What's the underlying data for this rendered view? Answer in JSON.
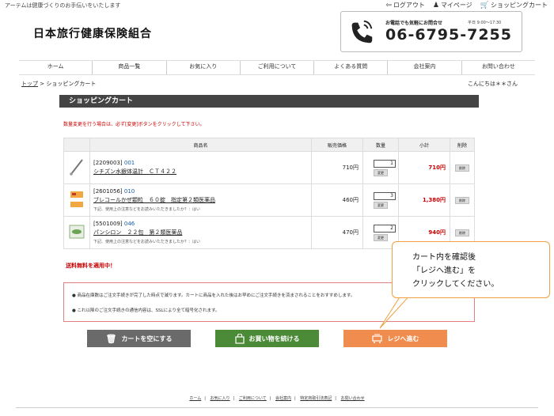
{
  "header": {
    "tagline": "アーテムは健康づくりのお手伝いをいたします",
    "links": [
      {
        "icon": "logout-icon",
        "glyph": "⇦",
        "label": "ログアウト"
      },
      {
        "icon": "user-icon",
        "glyph": "👤",
        "label": "マイページ"
      },
      {
        "icon": "cart-icon",
        "glyph": "🛒",
        "label": "ショッピングカート"
      }
    ],
    "logo": "日本旅行健康保険組合",
    "contact": {
      "label": "お電話でも気軽にお問合せ",
      "hours": "平日 9:00〜17:30",
      "phone": "06-6795-7255"
    }
  },
  "nav": [
    "ホーム",
    "商品一覧",
    "お気に入り",
    "ご利用について",
    "よくある質問",
    "会社案内",
    "お問い合わせ"
  ],
  "breadcrumb": {
    "top": "トップ",
    "separator": " > ",
    "current": "ショッピングカート"
  },
  "greeting": "こんにちは＊＊さん",
  "panel": {
    "title": "ショッピングカート",
    "notice": "数量変更を行う場合は、必ず[変更]ボタンをクリックして下さい。",
    "columns": [
      "",
      "商品名",
      "販売価格",
      "数量",
      "小計",
      "削除"
    ],
    "items": [
      {
        "code": "[2209003]",
        "sub": "001",
        "name": "シチズン水銀体温計　ＣＴ４２２",
        "note": "",
        "price": "710円",
        "qty": "1",
        "subtotal": "710円"
      },
      {
        "code": "[2601056]",
        "sub": "010",
        "name": "ブレコールかぜ顆粒　６０錠　指定第２類医薬品",
        "note": "下記、使用上の注意などをお読みいただきましたか？：はい",
        "price": "460円",
        "qty": "3",
        "subtotal": "1,380円"
      },
      {
        "code": "[5501009]",
        "sub": "046",
        "name": "パンシロン　２２包　第２類医薬品",
        "note": "下記、使用上の注意などをお読みいただきましたか？：はい",
        "price": "470円",
        "qty": "2",
        "subtotal": "940円"
      }
    ],
    "change_label": "変更",
    "delete_label": "削除",
    "shipping": "送料無料を適用中！",
    "info": [
      "● 商品在庫数はご注文手続きが完了した時点で減ります。カートに商品を入れた後はお早めにご注文手続きを済まされることをおすすめします。",
      "● これ以降のご注文手続きの通信内容は、SSLにより全て暗号化されます。"
    ]
  },
  "buttons": {
    "empty": "カートを空にする",
    "continue": "お買い物を続ける",
    "register": "レジへ進む"
  },
  "callout": [
    "カート内を確認後",
    "「レジへ進む」を",
    "クリックしてください。"
  ],
  "footer": [
    "ホーム",
    "お気に入り",
    "ご利用について",
    "会社案内",
    "特定商取引法表記",
    "お問い合わせ"
  ]
}
